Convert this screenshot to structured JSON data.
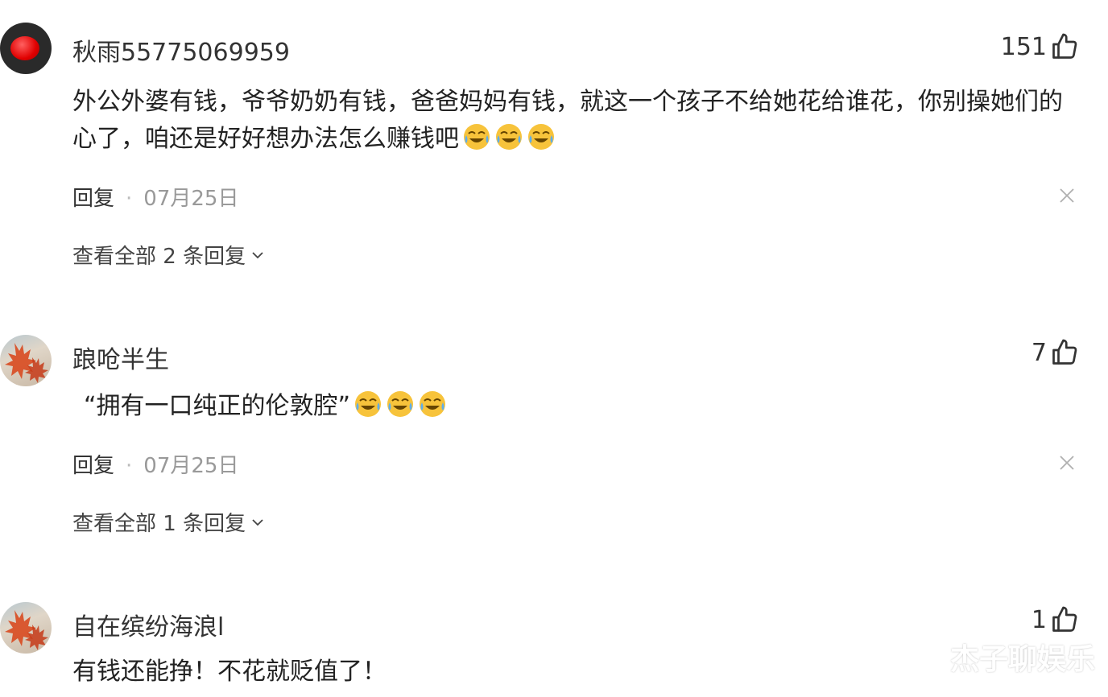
{
  "comments": [
    {
      "username": "秋雨55775069959",
      "likes": "151",
      "text": "外公外婆有钱，爷爷奶奶有钱，爸爸妈妈有钱，就这一个孩子不给她花给谁花，你别操她们的心了，咱还是好好想办法怎么赚钱吧",
      "reply_label": "回复",
      "date": "07月25日",
      "view_all": "查看全部 2 条回复",
      "avatar": "red-record-button-avatar",
      "emojis": [
        "crying-laughing",
        "crying-laughing",
        "crying-laughing"
      ]
    },
    {
      "username": "踉呛半生",
      "likes": "7",
      "text": "“拥有一口纯正的伦敦腔”",
      "reply_label": "回复",
      "date": "07月25日",
      "view_all": "查看全部 1 条回复",
      "avatar": "maple-leaf-avatar",
      "emojis": [
        "crying-laughing",
        "crying-laughing",
        "crying-laughing"
      ]
    },
    {
      "username": "自在缤纷海浪l",
      "likes": "1",
      "text": "有钱还能挣！不花就贬值了！",
      "avatar": "maple-leaf-avatar"
    }
  ],
  "watermark": "杰子聊娱乐",
  "colors": {
    "text": "#222222",
    "meta": "#999999",
    "background": "#ffffff"
  }
}
